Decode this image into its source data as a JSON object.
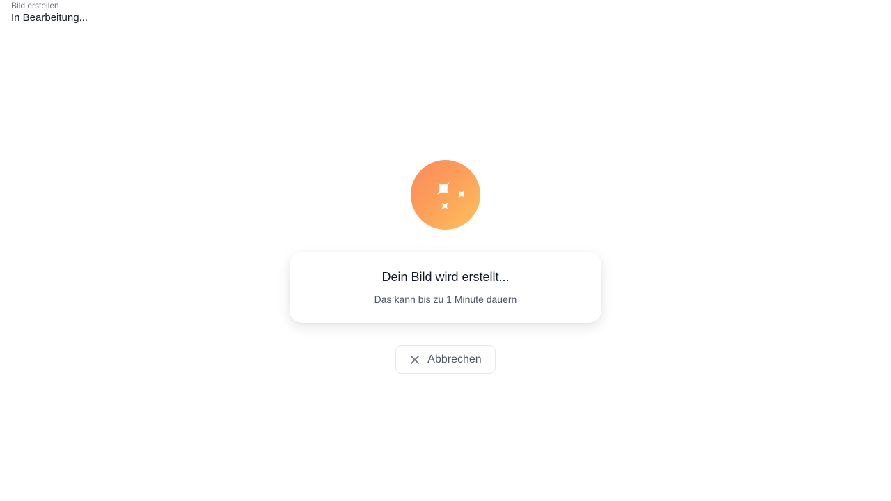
{
  "header": {
    "subtitle": "Bild erstellen",
    "title": "In Bearbeitung..."
  },
  "status_icon": {
    "icon": "sparkles-icon",
    "gradient": [
      "#fb8a5c",
      "#fec25a"
    ]
  },
  "card": {
    "heading": "Dein Bild wird erstellt...",
    "hint": "Das kann bis zu 1 Minute dauern"
  },
  "cancel": {
    "icon": "close-icon",
    "label": "Abbrechen"
  }
}
